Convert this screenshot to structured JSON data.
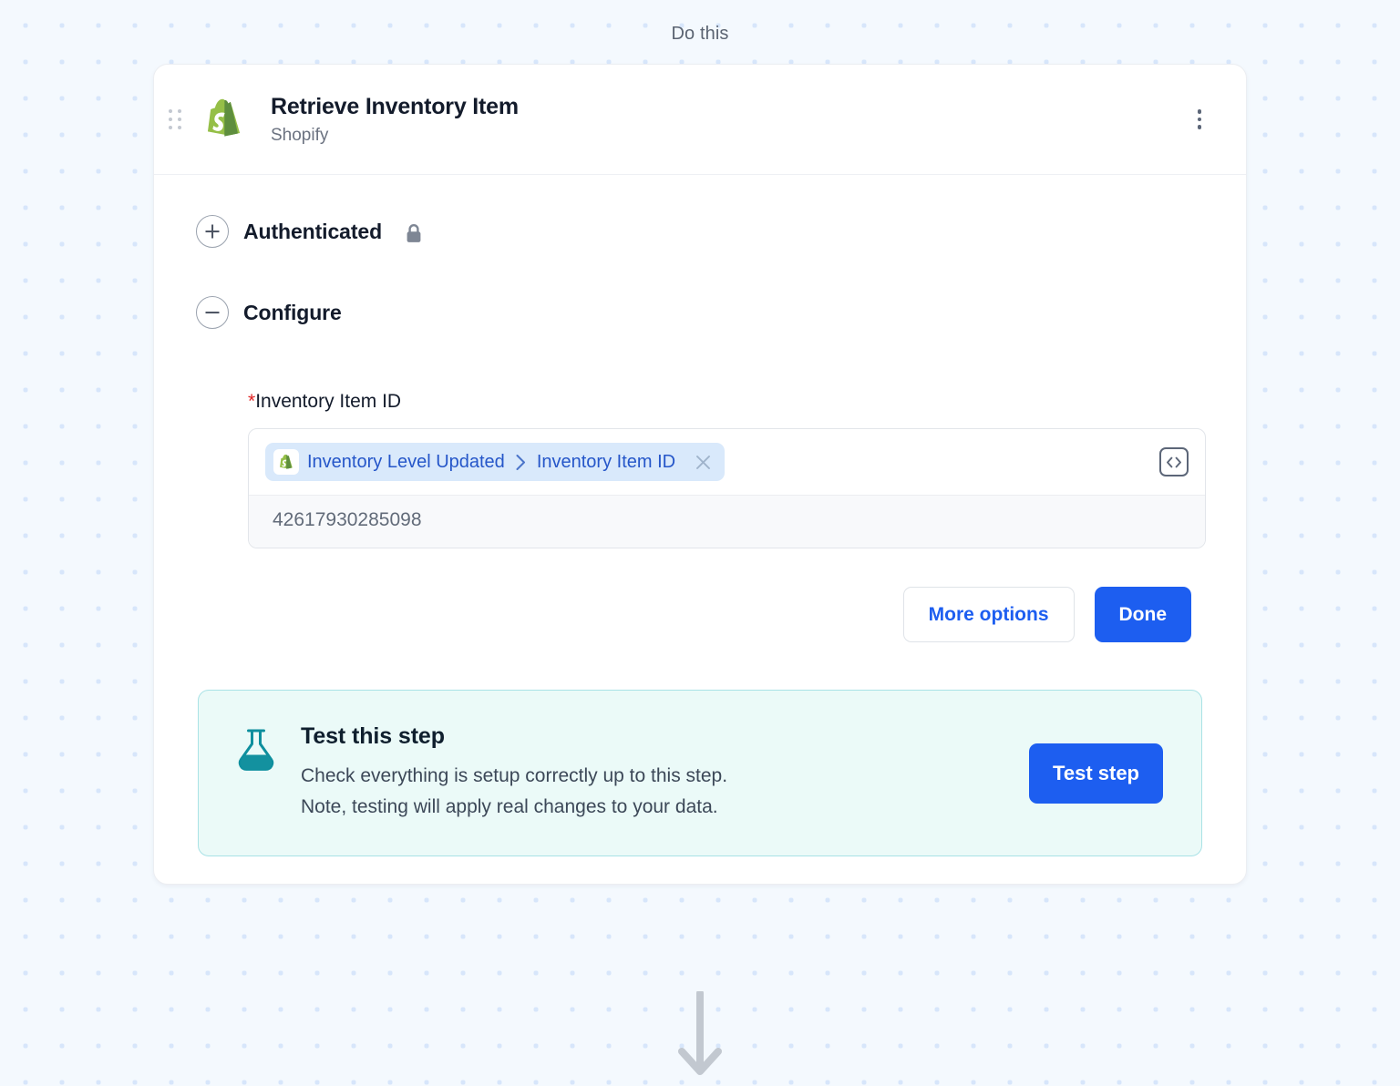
{
  "canvas": {
    "top_label": "Do this",
    "background_color": "#f4f9fe",
    "dot_color": "#d7e6fb",
    "flow_arrow_icon": "arrow-down-icon"
  },
  "step_card": {
    "drag_handle_icon": "drag-handle-icon",
    "app_logo_icon": "shopify-logo-icon",
    "title": "Retrieve Inventory Item",
    "app_name": "Shopify",
    "menu_icon": "kebab-menu-icon",
    "sections": [
      {
        "label": "Authenticated",
        "toggle_icon": "plus-circle-icon",
        "state": "collapsed",
        "lock_icon": "lock-icon"
      },
      {
        "label": "Configure",
        "toggle_icon": "minus-circle-icon",
        "state": "expanded"
      }
    ],
    "field": {
      "required_marker": "*",
      "label": "Inventory Item ID",
      "token": {
        "app_icon": "shopify-logo-icon",
        "source": "Inventory Level Updated",
        "separator_icon": "chevron-right-icon",
        "field": "Inventory Item ID",
        "remove_icon": "close-icon"
      },
      "code_toggle_icon": "code-brackets-icon",
      "resolved_value": "42617930285098"
    },
    "actions": {
      "more_options_label": "More options",
      "done_label": "Done"
    },
    "test_panel": {
      "icon": "flask-icon",
      "title": "Test this step",
      "description_line1": "Check everything is setup correctly up to this step.",
      "description_line2": "Note, testing will apply real changes to your data.",
      "button_label": "Test step",
      "background_color": "#ebfaf8",
      "border_color": "#a9e2e6",
      "accent_color": "#0e8f9e"
    }
  },
  "colors": {
    "primary_button": "#1d5ef0",
    "token_chip_bg": "#d9e9fb",
    "token_text": "#2556c9",
    "required_star": "#e02424",
    "shopify_green_light": "#95bf47",
    "shopify_green_dark": "#5e8e3e"
  }
}
